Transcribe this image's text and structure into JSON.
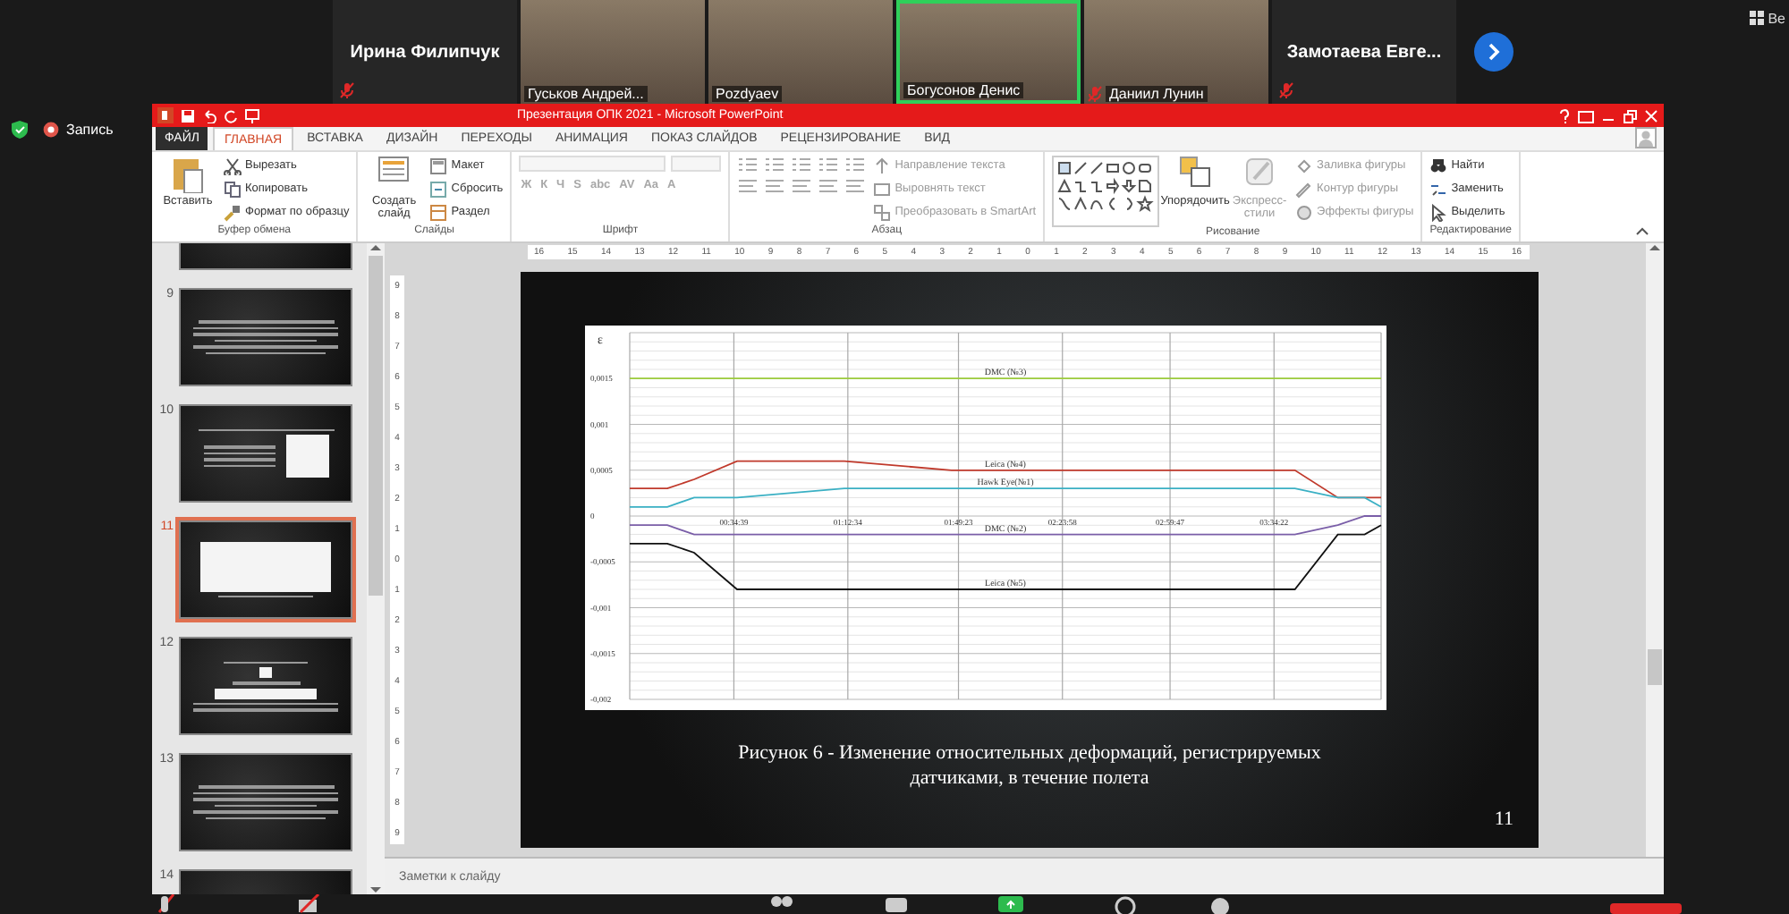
{
  "meeting": {
    "participants": [
      {
        "kind": "name",
        "name": "Ирина Филипчук",
        "muted": true,
        "active": false
      },
      {
        "kind": "video",
        "name": "Гуськов Андрей...",
        "muted": false,
        "active": false
      },
      {
        "kind": "video",
        "name": "Pozdyaev",
        "muted": false,
        "active": false
      },
      {
        "kind": "video",
        "name": "Богусонов Денис",
        "muted": false,
        "active": true
      },
      {
        "kind": "video",
        "name": "Даниил Лунин",
        "muted": true,
        "active": false
      },
      {
        "kind": "name",
        "name": "Замотаева  Евге...",
        "muted": true,
        "active": false
      }
    ],
    "view_button": "Ве",
    "recording": {
      "label": "Запись"
    }
  },
  "powerpoint": {
    "title": "Презентация ОПК 2021 -  Microsoft PowerPoint",
    "tabs": [
      {
        "kind": "file",
        "label": "ФАЙЛ",
        "selected": false
      },
      {
        "kind": "tab",
        "label": "ГЛАВНАЯ",
        "selected": true
      },
      {
        "kind": "tab",
        "label": "ВСТАВКА",
        "selected": false
      },
      {
        "kind": "tab",
        "label": "ДИЗАЙН",
        "selected": false
      },
      {
        "kind": "tab",
        "label": "ПЕРЕХОДЫ",
        "selected": false
      },
      {
        "kind": "tab",
        "label": "АНИМАЦИЯ",
        "selected": false
      },
      {
        "kind": "tab",
        "label": "ПОКАЗ СЛАЙДОВ",
        "selected": false
      },
      {
        "kind": "tab",
        "label": "РЕЦЕНЗИРОВАНИЕ",
        "selected": false
      },
      {
        "kind": "tab",
        "label": "ВИД",
        "selected": false
      }
    ],
    "ribbon": [
      {
        "kind": "clipboard",
        "label": "Буфер обмена",
        "items": [
          {
            "kind": "large",
            "label": "Вставить",
            "disabled": false
          },
          {
            "kind": "small",
            "label": "Вырезать",
            "disabled": false
          },
          {
            "kind": "small",
            "label": "Копировать",
            "disabled": false
          },
          {
            "kind": "small",
            "label": "Формат по образцу",
            "disabled": false
          }
        ]
      },
      {
        "kind": "slides",
        "label": "Слайды",
        "items": [
          {
            "kind": "large",
            "label": "Создать слайд",
            "disabled": false
          },
          {
            "kind": "small",
            "label": "Макет",
            "disabled": false
          },
          {
            "kind": "small",
            "label": "Сбросить",
            "disabled": false
          },
          {
            "kind": "small",
            "label": "Раздел",
            "disabled": false
          }
        ]
      },
      {
        "kind": "font",
        "label": "Шрифт",
        "items": [
          {
            "kind": "combo",
            "disabled": true
          },
          {
            "kind": "combo",
            "disabled": true
          },
          {
            "kind": "glyph",
            "label": "Ж",
            "disabled": true
          },
          {
            "kind": "glyph",
            "label": "К",
            "disabled": true
          },
          {
            "kind": "glyph",
            "label": "Ч",
            "disabled": true
          },
          {
            "kind": "glyph",
            "label": "S",
            "disabled": true
          },
          {
            "kind": "glyph",
            "label": "abc",
            "disabled": true
          },
          {
            "kind": "glyph",
            "label": "AV",
            "disabled": true
          },
          {
            "kind": "glyph",
            "label": "Aa",
            "disabled": true
          },
          {
            "kind": "glyph",
            "label": "A",
            "disabled": true
          }
        ]
      },
      {
        "kind": "paragraph",
        "label": "Абзац",
        "items": [
          {
            "kind": "small",
            "label": "Направление текста",
            "disabled": true
          },
          {
            "kind": "small",
            "label": "Выровнять текст",
            "disabled": true
          },
          {
            "kind": "small",
            "label": "Преобразовать в SmartArt",
            "disabled": true
          }
        ]
      },
      {
        "kind": "drawing",
        "label": "Рисование",
        "items": [
          {
            "kind": "gallery",
            "disabled": false
          },
          {
            "kind": "large",
            "label": "Упорядочить",
            "disabled": false
          },
          {
            "kind": "large",
            "label": "Экспресс-стили",
            "disabled": true
          },
          {
            "kind": "small",
            "label": "Заливка фигуры",
            "disabled": true
          },
          {
            "kind": "small",
            "label": "Контур фигуры",
            "disabled": true
          },
          {
            "kind": "small",
            "label": "Эффекты фигуры",
            "disabled": true
          }
        ]
      },
      {
        "kind": "editing",
        "label": "Редактирование",
        "items": [
          {
            "kind": "small",
            "label": "Найти",
            "disabled": false
          },
          {
            "kind": "small",
            "label": "Заменить",
            "disabled": false
          },
          {
            "kind": "small",
            "label": "Выделить",
            "disabled": false
          }
        ]
      }
    ],
    "ruler_horizontal": [
      "16",
      "15",
      "14",
      "13",
      "12",
      "11",
      "10",
      "9",
      "8",
      "7",
      "6",
      "5",
      "4",
      "3",
      "2",
      "1",
      "0",
      "1",
      "2",
      "3",
      "4",
      "5",
      "6",
      "7",
      "8",
      "9",
      "10",
      "11",
      "12",
      "13",
      "14",
      "15",
      "16"
    ],
    "ruler_vertical": [
      "9",
      "8",
      "7",
      "6",
      "5",
      "4",
      "3",
      "2",
      "1",
      "0",
      "1",
      "2",
      "3",
      "4",
      "5",
      "6",
      "7",
      "8",
      "9"
    ],
    "slides": [
      {
        "kind": "figures",
        "selected": false
      },
      {
        "kind": "text",
        "number": "9",
        "selected": false
      },
      {
        "kind": "figure-text",
        "number": "10",
        "selected": false
      },
      {
        "kind": "chart",
        "number": "11",
        "selected": true
      },
      {
        "kind": "table",
        "number": "12",
        "selected": false
      },
      {
        "kind": "text",
        "number": "13",
        "selected": false
      },
      {
        "kind": "text",
        "number": "14",
        "selected": false
      }
    ],
    "slide": {
      "chart_data": {
        "type": "line",
        "ylabel": "ε",
        "x": [
          0,
          12.5,
          21.4,
          35.7,
          71.4,
          107.1,
          139.2,
          178.5,
          221.3,
          235.6,
          244.5,
          250
        ],
        "xlim": [
          0,
          250
        ],
        "ylim": [
          -0.002,
          0.002
        ],
        "grid": true,
        "xticks": [
          {
            "value": 34.65,
            "label": "00:34:39"
          },
          {
            "value": 72.57,
            "label": "01:12:34"
          },
          {
            "value": 109.38,
            "label": "01:49:23"
          },
          {
            "value": 143.97,
            "label": "02:23:58"
          },
          {
            "value": 179.78,
            "label": "02:59:47"
          },
          {
            "value": 214.37,
            "label": "03:34:22"
          }
        ],
        "yticks": [
          {
            "value": 0.0015,
            "label": "0,0015"
          },
          {
            "value": 0.001,
            "label": "0,001"
          },
          {
            "value": 0.0005,
            "label": "0,0005"
          },
          {
            "value": 0,
            "label": "0"
          },
          {
            "value": -0.0005,
            "label": "-0,0005"
          },
          {
            "value": -0.001,
            "label": "-0,001"
          },
          {
            "value": -0.0015,
            "label": "-0,0015"
          },
          {
            "value": -0.002,
            "label": "-0,002"
          }
        ],
        "series": [
          {
            "name": "DMC (№3)",
            "color": "#9ccc3c",
            "values": [
              0.0015,
              0.0015,
              0.0015,
              0.0015,
              0.0015,
              0.0015,
              0.0015,
              0.0015,
              0.0015,
              0.0015,
              0.0015,
              0.0015
            ]
          },
          {
            "name": "Leica (№4)",
            "color": "#c0392b",
            "values": [
              0.0003,
              0.0003,
              0.0004,
              0.0006,
              0.0006,
              0.0005,
              0.0005,
              0.0005,
              0.0005,
              0.0002,
              0.0002,
              0.0002
            ]
          },
          {
            "name": "Hawk Eye(№1)",
            "color": "#3ab0c4",
            "values": [
              0.0001,
              0.0001,
              0.0002,
              0.0002,
              0.0003,
              0.0003,
              0.0003,
              0.0003,
              0.0003,
              0.0002,
              0.0002,
              0.0001
            ]
          },
          {
            "name": "DMC (№2)",
            "color": "#7a5ea8",
            "values": [
              -0.0001,
              -0.0001,
              -0.0002,
              -0.0002,
              -0.0002,
              -0.0002,
              -0.0002,
              -0.0002,
              -0.0002,
              -0.0001,
              0,
              0
            ]
          },
          {
            "name": "Leica (№5)",
            "color": "#111111",
            "values": [
              -0.0003,
              -0.0003,
              -0.0004,
              -0.0008,
              -0.0008,
              -0.0008,
              -0.0008,
              -0.0008,
              -0.0008,
              -0.0002,
              -0.0002,
              -0.0001
            ]
          }
        ]
      },
      "caption": "Рисунок 6 - Изменение относительных деформаций, регистрируемых датчиками, в течение полета",
      "number": "11"
    },
    "notes_placeholder": "Заметки к слайду"
  }
}
